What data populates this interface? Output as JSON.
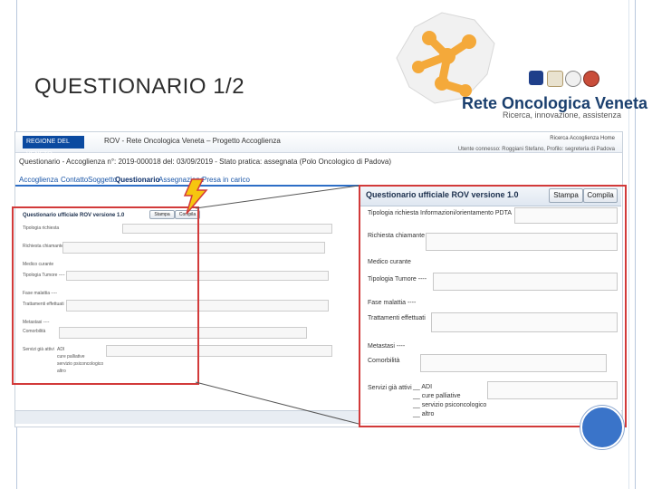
{
  "slide": {
    "title": "QUESTIONARIO 1/2"
  },
  "logo": {
    "name": "Rete Oncologica Veneta",
    "tagline": "Ricerca, innovazione, assistenza"
  },
  "app": {
    "region": "REGIONE DEL VENETO",
    "title": "ROV - Rete Oncologica Veneta – Progetto Accoglienza",
    "user_links": "Ricerca Accoglienza   Home",
    "user_sub": "Utente connesso: Roggiani Stefano, Profilo: segreteria di Padova",
    "breadcrumb": "Questionario - Accoglienza n°: 2019-000018 del: 03/09/2019 - Stato pratica: assegnata (Polo Oncologico di Padova)",
    "steps": [
      "Accoglienza",
      "Contatto",
      "Soggetto",
      "Questionario",
      "Assegnazione",
      "Presa in carico"
    ]
  },
  "questionnaire": {
    "title": "Questionario ufficiale ROV versione 1.0",
    "stampa_label": "Stampa",
    "compila_label": "Compila",
    "tipologia_label": "Tipologia richiesta",
    "tipologia_value": "Informazioni/orientamento PDTA",
    "richiesta_label": "Richiesta chiamante",
    "medico_label": "Medico curante",
    "tumore_label": "Tipologia Tumore ----",
    "fase_label": "Fase malattia ----",
    "trattamenti_label": "Trattamenti effettuati",
    "metastasi_label": "Metastasi ----",
    "comorbilita_label": "Comorbilità",
    "servizi_label": "Servizi già attivi",
    "servizi": [
      "ADI",
      "cure palliative",
      "servizio psiconcologico",
      "altro"
    ]
  },
  "colors": {
    "accent": "#1a56a8",
    "highlight": "#d23a3a",
    "logo_orange": "#f4a93a"
  }
}
